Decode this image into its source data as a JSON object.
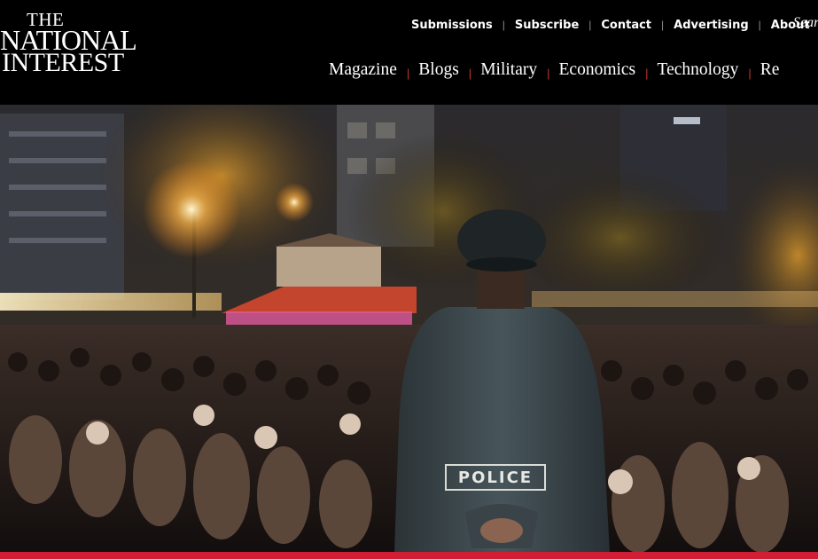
{
  "logo": {
    "line1": "THE",
    "line2": "NATIONAL",
    "line3": "INTEREST"
  },
  "utility_nav": [
    {
      "label": "Submissions"
    },
    {
      "label": "Subscribe"
    },
    {
      "label": "Contact"
    },
    {
      "label": "Advertising"
    },
    {
      "label": "About"
    }
  ],
  "utility_separator": "|",
  "search": {
    "label": "Sear"
  },
  "main_nav": [
    {
      "label": "Magazine"
    },
    {
      "label": "Blogs"
    },
    {
      "label": "Military"
    },
    {
      "label": "Economics"
    },
    {
      "label": "Technology"
    },
    {
      "label": "Re"
    }
  ],
  "main_separator": "|",
  "hero": {
    "badge_text": "POLICE"
  },
  "colors": {
    "accent": "#d21e35",
    "header_bg": "#000000",
    "nav_text": "#ffffff"
  }
}
